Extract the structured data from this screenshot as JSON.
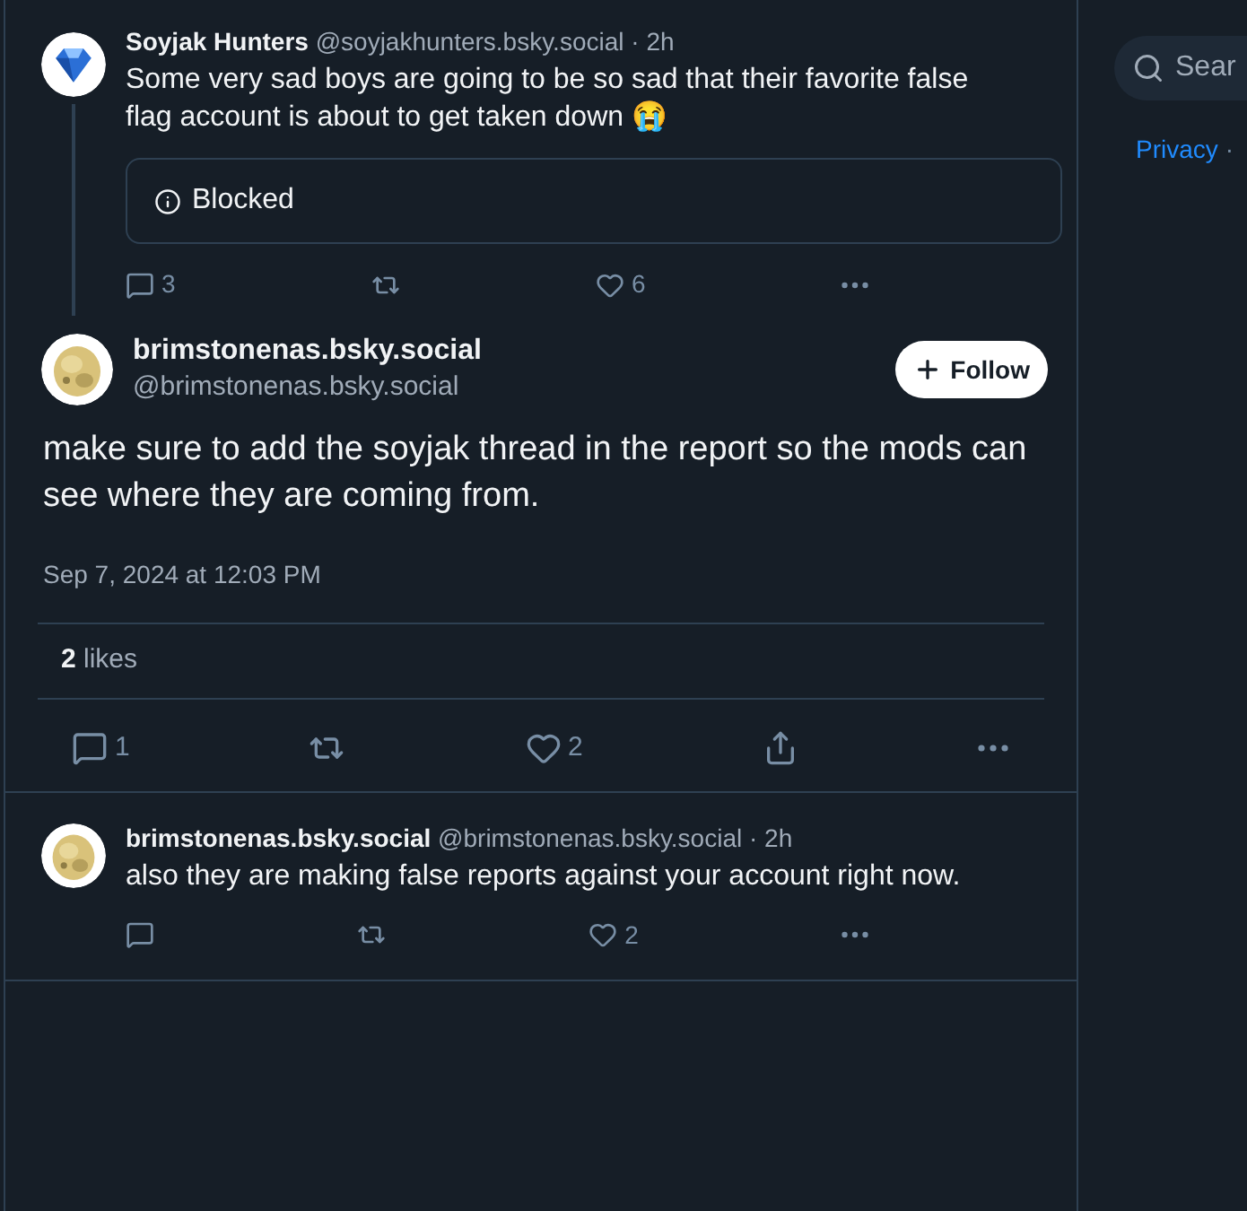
{
  "parent_post": {
    "display_name": "Soyjak Hunters",
    "handle": "@soyjakhunters.bsky.social",
    "time": "· 2h",
    "text": "Some very sad boys are going to be so sad that their favorite false flag account is about to get taken down 😭",
    "embed": {
      "label": "Blocked"
    },
    "actions": {
      "replies": "3",
      "likes": "6",
      "liked": false
    }
  },
  "main_post": {
    "display_name": "brimstonenas.bsky.social",
    "handle": "@brimstonenas.bsky.social",
    "follow_button": "Follow",
    "text": "make sure to add the soyjak thread in the report so the mods can see where they are coming from.",
    "timestamp": "Sep 7, 2024 at 12:03 PM",
    "likes_count": "2",
    "likes_label": "likes",
    "actions": {
      "replies": "1",
      "likes": "2",
      "liked": false
    }
  },
  "reply": {
    "display_name": "brimstonenas.bsky.social",
    "handle": "@brimstonenas.bsky.social",
    "time": "· 2h",
    "text": "also they are making false reports against your account right now.",
    "actions": {
      "likes": "2",
      "liked": false
    }
  },
  "sidebar": {
    "search": {
      "placeholder": "Sear"
    },
    "links": [
      {
        "label": "Privacy"
      },
      {
        "label": "·"
      }
    ]
  }
}
